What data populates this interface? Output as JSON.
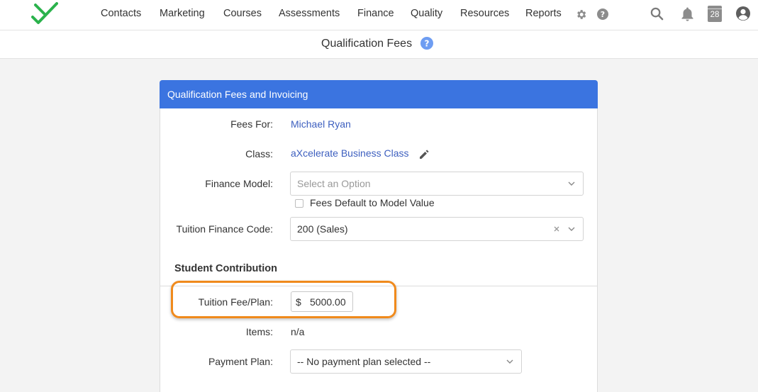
{
  "nav": {
    "items": [
      "Contacts",
      "Marketing",
      "Courses",
      "Assessments",
      "Finance",
      "Quality",
      "Resources",
      "Reports"
    ],
    "calendar_day": "28",
    "icons": [
      "logo-check",
      "gear-icon",
      "help-icon",
      "search-icon",
      "bell-icon",
      "calendar-icon",
      "user-avatar-icon"
    ]
  },
  "page": {
    "title": "Qualification Fees"
  },
  "card": {
    "header": "Qualification Fees and Invoicing",
    "fees_for_label": "Fees For:",
    "fees_for_value": "Michael Ryan",
    "class_label": "Class:",
    "class_value": "aXcelerate Business Class",
    "finance_model_label": "Finance Model:",
    "finance_model_placeholder": "Select an Option",
    "fees_default_label": "Fees Default to Model Value",
    "fees_default_checked": false,
    "tuition_code_label": "Tuition Finance Code:",
    "tuition_code_value": "200 (Sales)",
    "section_title": "Student Contribution",
    "tuition_fee_label": "Tuition Fee/Plan:",
    "currency_symbol": "$",
    "tuition_fee_value": "5000.00",
    "items_label": "Items:",
    "items_value": "n/a",
    "payment_plan_label": "Payment Plan:",
    "payment_plan_value": "-- No payment plan selected --"
  },
  "colors": {
    "accent_blue": "#3b74e0",
    "link_blue": "#3d5fbf",
    "highlight_orange": "#f08a1c",
    "logo_green": "#2bb24c"
  }
}
